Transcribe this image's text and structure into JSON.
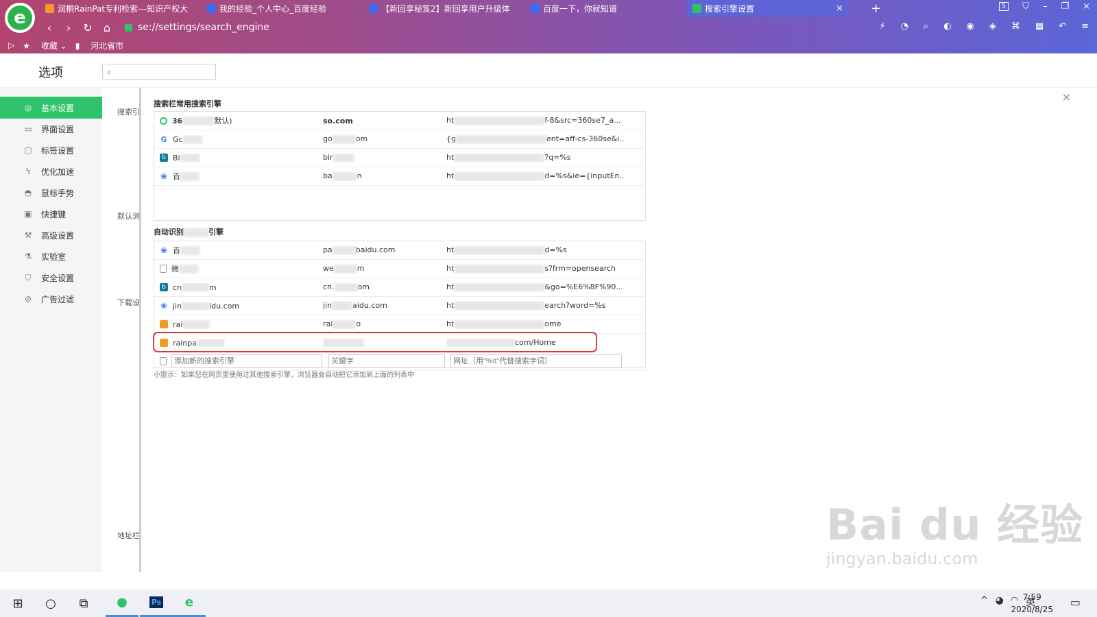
{
  "browser": {
    "tabs": [
      {
        "title": "润桐RainPat专利检索---知识产权大",
        "favcolor": "#f19a27"
      },
      {
        "title": "我的经验_个人中心_百度经验",
        "favcolor": "#3a6df0"
      },
      {
        "title": "【新回享秘笈2】新回享用户升级体",
        "favcolor": "#3a6df0"
      },
      {
        "title": "百度一下，你就知道",
        "favcolor": "#3a6df0"
      },
      {
        "title": "搜索引擎设置",
        "favcolor": "#2dc26b"
      }
    ],
    "tab_count_badge": "5",
    "url": "se://settings/search_engine",
    "bookmarks": {
      "fav_label": "收藏",
      "folder_label": "河北省市"
    }
  },
  "page": {
    "title": "选项",
    "search_placeholder": ""
  },
  "sidebar": {
    "items": [
      {
        "label": "基本设置",
        "icon": "circle-gear-icon"
      },
      {
        "label": "界面设置",
        "icon": "window-icon"
      },
      {
        "label": "标签设置",
        "icon": "tab-icon"
      },
      {
        "label": "优化加速",
        "icon": "bolt-icon"
      },
      {
        "label": "鼠标手势",
        "icon": "mouse-icon"
      },
      {
        "label": "快捷键",
        "icon": "keyboard-icon"
      },
      {
        "label": "高级设置",
        "icon": "wrench-icon"
      },
      {
        "label": "实验室",
        "icon": "flask-icon"
      },
      {
        "label": "安全设置",
        "icon": "shield-icon"
      },
      {
        "label": "广告过滤",
        "icon": "block-icon"
      }
    ]
  },
  "bg_labels": [
    "搜索引",
    "默认浏",
    "下载设",
    "地址栏"
  ],
  "dialog": {
    "section1_title": "搜索栏常用搜索引擎",
    "common_engines": [
      {
        "icon": "so",
        "name_a": "36",
        "name_b": "默认)",
        "keyword_a": "so.com",
        "keyword_b": "",
        "url_a": "ht",
        "url_b": "f-8&src=360se7_a..."
      },
      {
        "icon": "g",
        "name_a": "Gc",
        "name_b": "",
        "keyword_a": "go",
        "keyword_b": "om",
        "url_a": "{g",
        "url_b": "ent=aff-cs-360se&i..."
      },
      {
        "icon": "bing",
        "name_a": "Bi",
        "name_b": "",
        "keyword_a": "bir",
        "keyword_b": "",
        "url_a": "ht",
        "url_b": "?q=%s"
      },
      {
        "icon": "baidu",
        "name_a": "百",
        "name_b": "",
        "keyword_a": "ba",
        "keyword_b": "n",
        "url_a": "ht",
        "url_b": "d=%s&ie={inputEn..."
      }
    ],
    "section2_title_a": "自动识别",
    "section2_title_b": "引擎",
    "auto_engines": [
      {
        "icon": "baidu",
        "name_a": "百",
        "name_b": "",
        "keyword_a": "pa",
        "keyword_b": "baidu.com",
        "url_a": "ht",
        "url_b": "d=%s"
      },
      {
        "icon": "doc",
        "name_a": "微",
        "name_b": "",
        "keyword_a": "we",
        "keyword_b": "m",
        "url_a": "ht",
        "url_b": "s?frm=opensearch"
      },
      {
        "icon": "bing",
        "name_a": "cn",
        "name_b": "m",
        "keyword_a": "cn.",
        "keyword_b": "om",
        "url_a": "ht",
        "url_b": "&go=%E6%8F%90..."
      },
      {
        "icon": "baidu",
        "name_a": "jin",
        "name_b": "idu.com",
        "keyword_a": "jin",
        "keyword_b": "aidu.com",
        "url_a": "ht",
        "url_b": "earch?word=%s"
      },
      {
        "icon": "rain",
        "name_a": "rai",
        "name_b": "",
        "keyword_a": "rai",
        "keyword_b": "o",
        "url_a": "ht",
        "url_b": "ome"
      },
      {
        "icon": "rain",
        "name_a": "rainpa",
        "name_b": "",
        "keyword_a": "",
        "keyword_b": "",
        "url_a": "",
        "url_b": "com/Home"
      }
    ],
    "add_row": {
      "name_placeholder": "添加新的搜索引擎",
      "keyword_placeholder": "关键字",
      "url_placeholder": "网址（用\"%s\"代替搜索字词）"
    },
    "tip": "小提示：如果您在网页里使用过其他搜索引擎，浏览器会自动把它添加到上面的列表中"
  },
  "watermark": {
    "big": "Bai du 经验",
    "small": "jingyan.baidu.com"
  },
  "taskbar": {
    "time": "7:59",
    "date": "2020/8/25",
    "ime": "英"
  },
  "colors": {
    "accent": "#2dc26b",
    "highlight": "#d83a3a"
  }
}
